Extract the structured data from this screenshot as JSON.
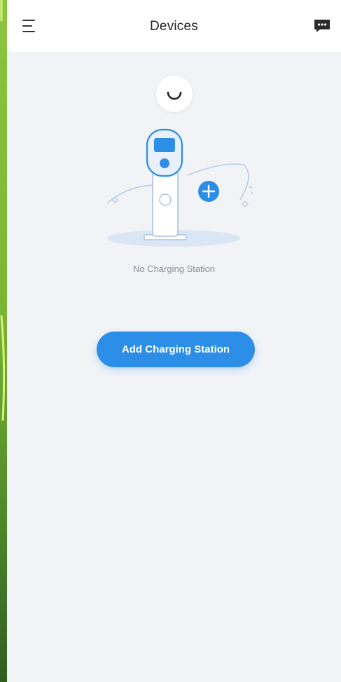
{
  "header": {
    "title": "Devices",
    "menu_icon": "hamburger-menu-icon",
    "message_icon": "message-icon"
  },
  "loading": {
    "icon": "loading-spinner-icon"
  },
  "empty_state": {
    "illustration": "charging-station-illustration",
    "message": "No Charging Station"
  },
  "actions": {
    "add_label": "Add Charging Station"
  },
  "colors": {
    "accent": "#2d8ee8",
    "background": "#f2f3f7",
    "header_bg": "#ffffff",
    "wallpaper": "#8cc63f"
  }
}
